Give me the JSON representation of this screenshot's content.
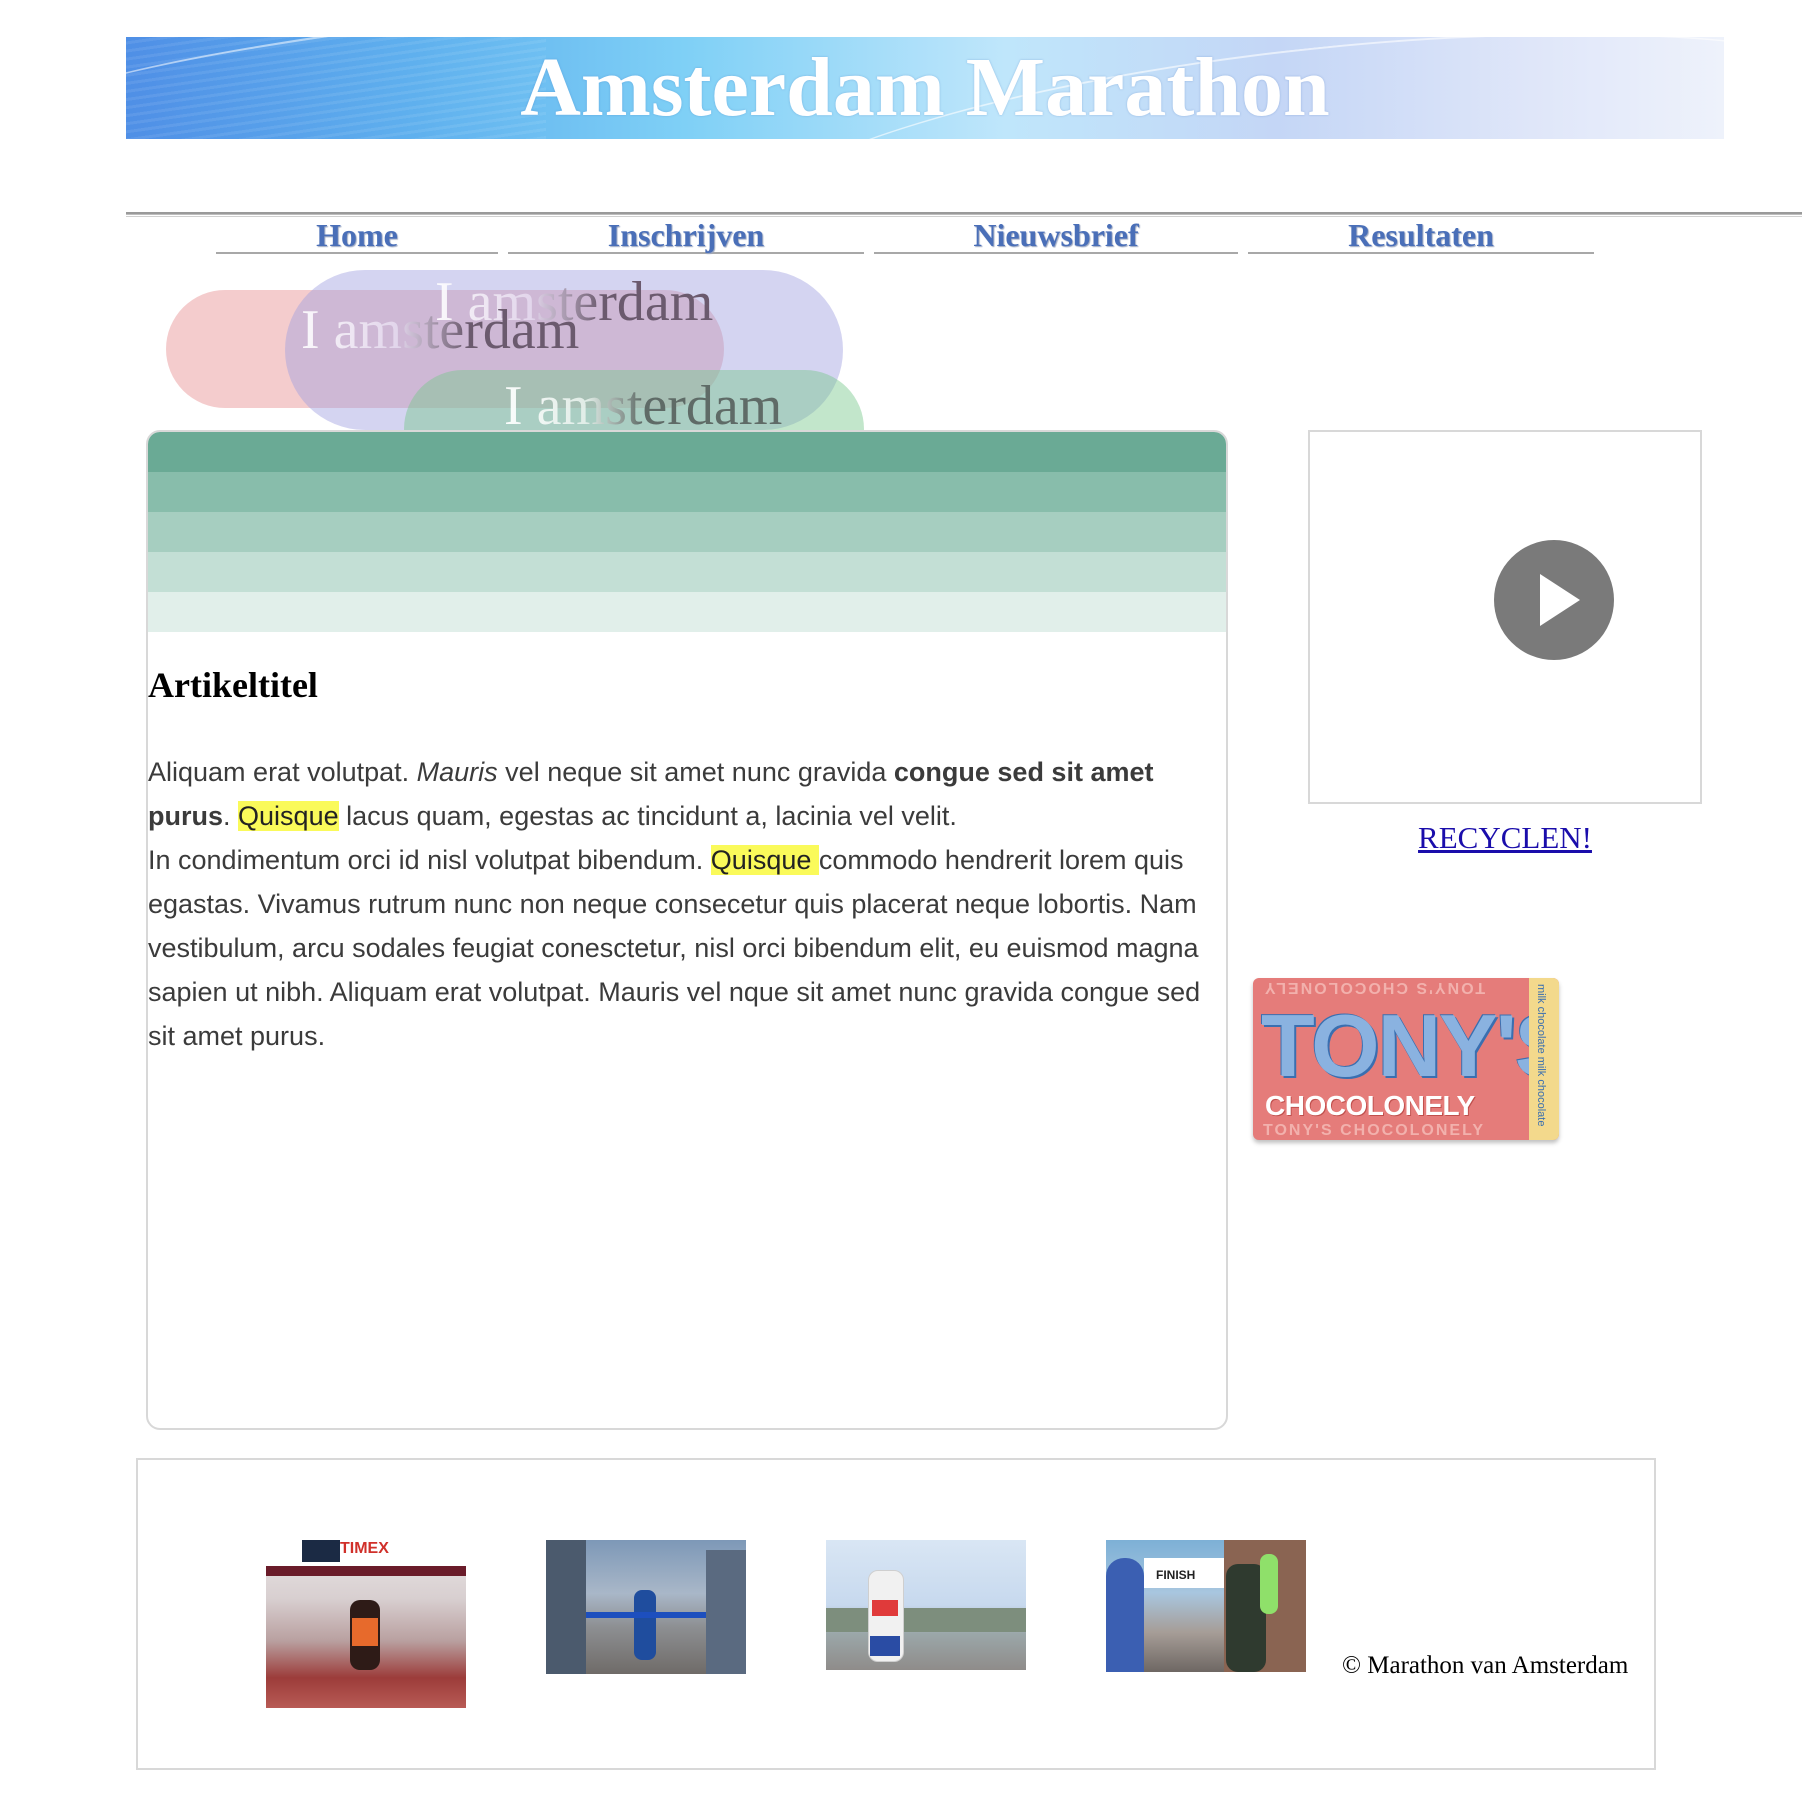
{
  "header": {
    "title": "Amsterdam Marathon"
  },
  "nav": {
    "items": [
      {
        "label": "Home"
      },
      {
        "label": "Inschrijven"
      },
      {
        "label": "Nieuwsbrief"
      },
      {
        "label": "Resultaten"
      }
    ]
  },
  "bubbles": {
    "red_text": "I amsterdam",
    "blue_text": "I amsterdam",
    "green_text": "I amsterdam",
    "colors": {
      "red": "#ecaaac",
      "blue": "#a0a0e1",
      "green": "#78c88c"
    }
  },
  "article": {
    "title": "Artikeltitel",
    "p1_a": "Aliquam erat volutpat. ",
    "p1_italic": "Mauris",
    "p1_b": " vel neque sit amet nunc gravida ",
    "p1_bold": "congue sed sit amet purus",
    "p1_c": ". ",
    "p1_highlight": "Quisque",
    "p1_d": " lacus quam, egestas ac tincidunt a, lacinia vel velit.",
    "p2_a": "In condimentum orci id nisl volutpat bibendum. ",
    "p2_highlight": "Quisque ",
    "p2_b": "commodo hendrerit lorem quis egastas. Vivamus rutrum nunc non neque consecetur quis placerat neque lobortis. Nam vestibulum, arcu sodales feugiat conesctetur, nisl orci bibendum elit, eu euismod magna sapien ut nibh. Aliquam erat volutpat. Mauris vel nque sit amet nunc gravida congue sed sit amet purus.",
    "header_band_colors": [
      "#6aaa95",
      "#88bdab",
      "#a6cec0",
      "#c3dfd5",
      "#e1efea"
    ],
    "highlight_color": "#fafa5a"
  },
  "sidebar": {
    "video_icon": "play-icon",
    "recycle_link": "RECYCLEN!",
    "ad": {
      "brand": "TONY'S",
      "sub": "CHOCOLONELY",
      "repeat": "TONY'S CHOCOLONELY",
      "side": "milk chocolate  milk chocolate"
    }
  },
  "footer": {
    "photos": [
      {
        "name": "london-marathon-winner-photo",
        "banner": "TIMEX"
      },
      {
        "name": "runner-finish-tape-photo"
      },
      {
        "name": "runner-arms-raised-photo"
      },
      {
        "name": "runner-finish-arch-photo",
        "banner": "FINISH"
      }
    ],
    "copyright": "© Marathon van Amsterdam"
  }
}
